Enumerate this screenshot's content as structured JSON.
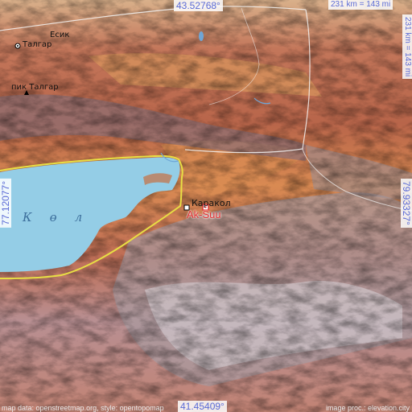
{
  "coords": {
    "north": "43.52768°",
    "south": "41.45409°",
    "west": "77.12077°",
    "east": "79.93327°"
  },
  "scale": {
    "top": "231 km = 143 mi",
    "right": "231 km = 143 mi"
  },
  "places": {
    "esik": "Есик",
    "talgar": "Талгар",
    "peak": "пик Талгар",
    "karakol": "Каракол",
    "target": "Ak-Suu"
  },
  "lake_label": "Көл",
  "footer": {
    "left": "map data: openstreetmap.org, style: opentopomap",
    "right": "image proc.: elevation.city"
  },
  "colors": {
    "lake": "#94cde6",
    "border": "#e8df44",
    "target": "#e03030",
    "accent": "#5b6bd6"
  }
}
